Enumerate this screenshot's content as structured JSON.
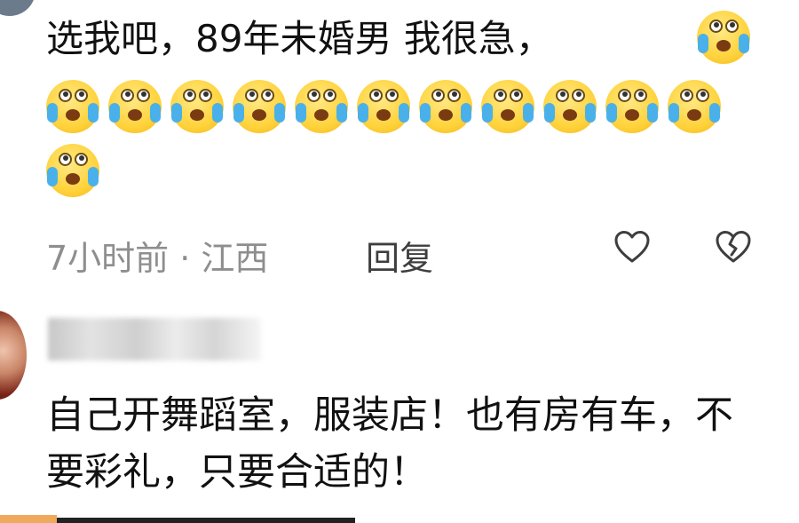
{
  "comment1": {
    "text": "选我吧，89年未婚男 我很急，",
    "emoji_name": "crying-emoji",
    "emoji_count": 13,
    "time": "7小时前 · 江西",
    "reply_label": "回复",
    "like_icon": "heart-icon",
    "dislike_icon": "broken-heart-icon"
  },
  "comment2": {
    "text": "自己开舞蹈室，服装店！也有房有车，不要彩礼，只要合适的！"
  },
  "colors": {
    "meta": "#8e8e8e",
    "emoji_yellow": "#ffd23a",
    "tear_blue": "#4ab0ea"
  }
}
